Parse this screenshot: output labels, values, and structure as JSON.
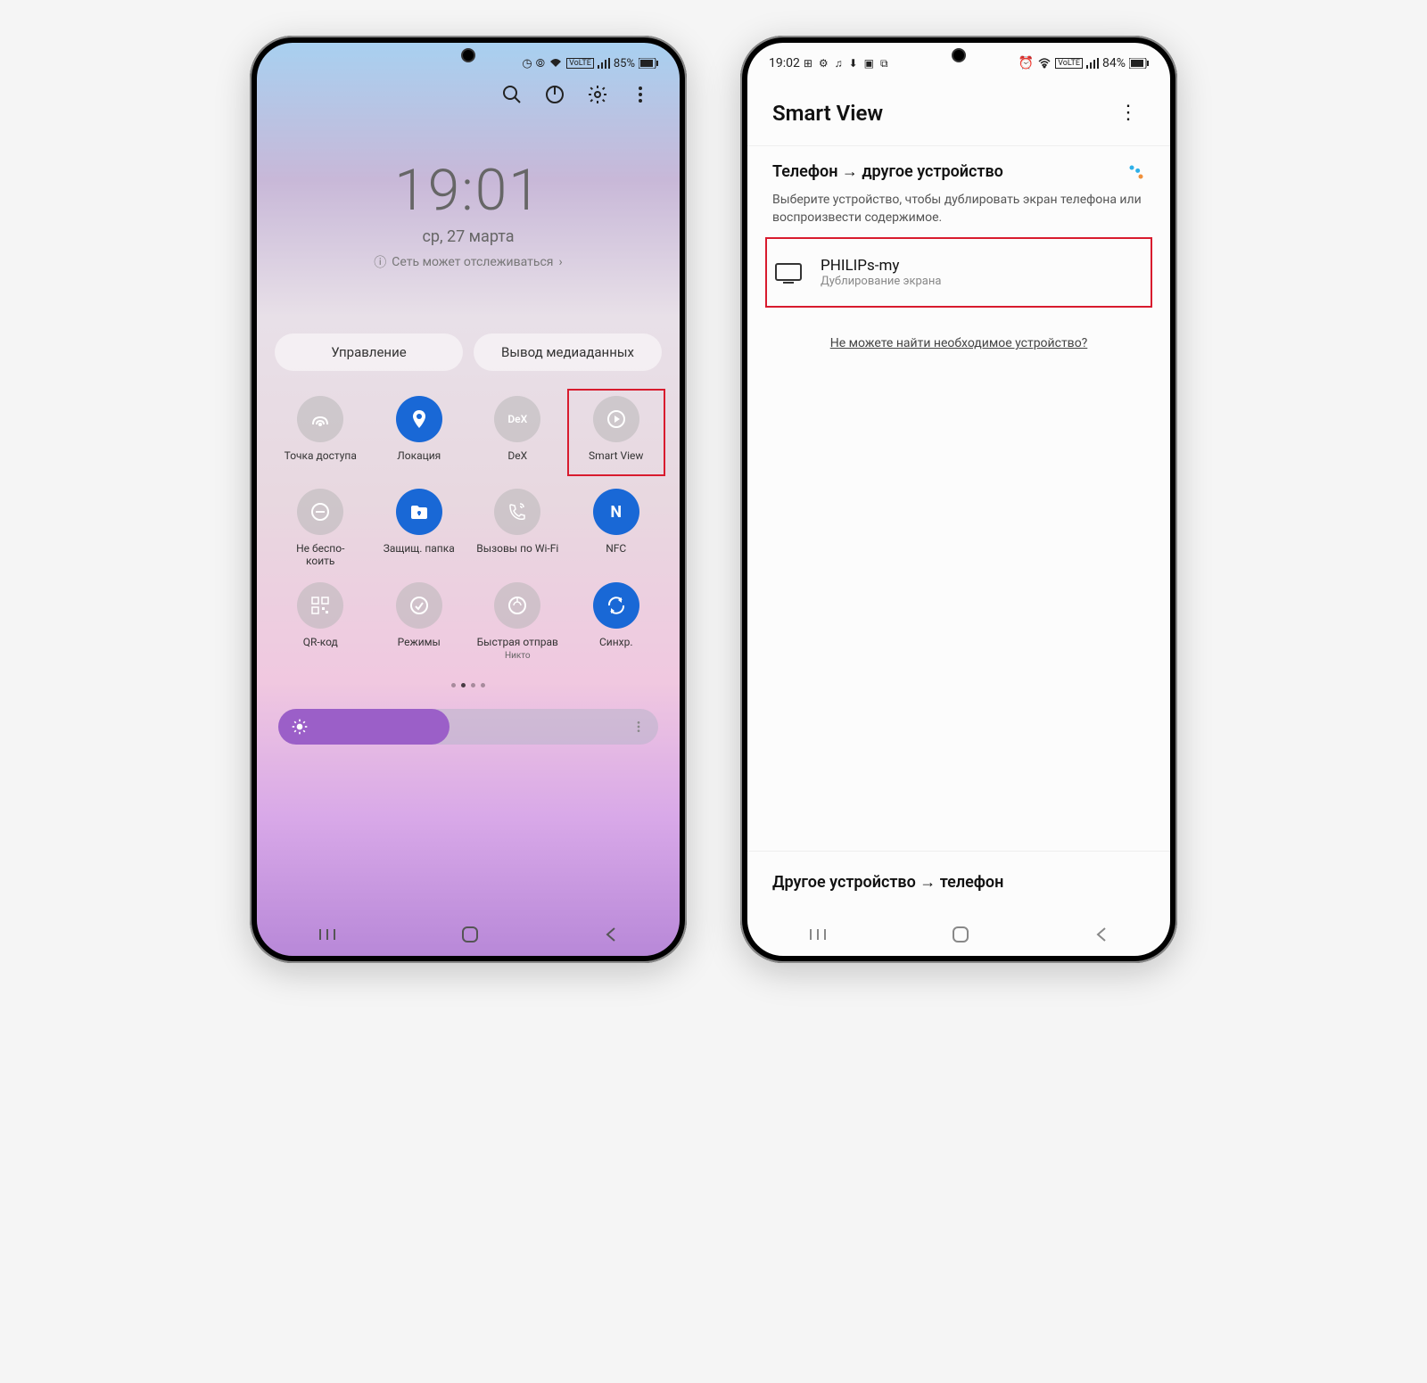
{
  "phone1": {
    "status": {
      "battery": "85%"
    },
    "clock": {
      "time": "19:01",
      "date": "ср, 27 марта",
      "network_notice": "Сеть может отслеживаться"
    },
    "tabs": {
      "control": "Управление",
      "media": "Вывод медиаданных"
    },
    "tiles": {
      "hotspot": "Точка доступа",
      "location": "Локация",
      "dex": "DeX",
      "smartview": "Smart View",
      "dnd": "Не беспо-\nкоить",
      "secure_folder": "Защищ. папка",
      "wifi_calls": "Вызовы по Wi-Fi",
      "nfc": "NFC",
      "qr": "QR-код",
      "modes": "Режимы",
      "quick_share": "Быстрая отправ",
      "quick_share_sub": "Никто",
      "sync": "Синхр."
    }
  },
  "phone2": {
    "status": {
      "time": "19:02",
      "battery": "84%"
    },
    "title": "Smart View",
    "section1": {
      "title": "Телефон → другое устройство",
      "desc": "Выберите устройство, чтобы дублировать экран телефона или воспроизвести содержимое."
    },
    "device": {
      "name": "PHILIPs-my",
      "sub": "Дублирование экрана"
    },
    "help_link": "Не можете найти необходимое устройство?",
    "section2": {
      "title": "Другое устройство → телефон"
    }
  }
}
